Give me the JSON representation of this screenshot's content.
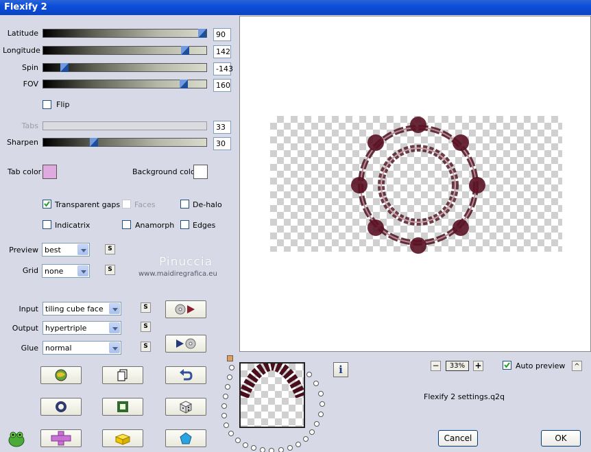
{
  "window": {
    "title": "Flexify 2"
  },
  "sliders": {
    "latitude": {
      "label": "Latitude",
      "value": "90",
      "fraction": 1.0
    },
    "longitude": {
      "label": "Longitude",
      "value": "142",
      "fraction": 0.89
    },
    "spin": {
      "label": "Spin",
      "value": "-143",
      "fraction": 0.11
    },
    "fov": {
      "label": "FOV",
      "value": "160",
      "fraction": 0.88
    },
    "tabs": {
      "label": "Tabs",
      "value": "33"
    },
    "sharpen": {
      "label": "Sharpen",
      "value": "30",
      "fraction": 0.3
    }
  },
  "flip": {
    "label": "Flip",
    "checked": false
  },
  "colors": {
    "tab_color_label": "Tab color",
    "tab_color": "#dfaae0",
    "background_color_label": "Background color",
    "background_color": "#ffffff"
  },
  "options": {
    "transparent_gaps": "Transparent gaps",
    "faces": "Faces",
    "de_halo": "De-halo",
    "indicatrix": "Indicatrix",
    "anamorph": "Anamorph",
    "edges": "Edges"
  },
  "preview_select": {
    "label": "Preview",
    "value": "best"
  },
  "grid_select": {
    "label": "Grid",
    "value": "none"
  },
  "input_select": {
    "label": "Input",
    "value": "tiling cube face"
  },
  "output_select": {
    "label": "Output",
    "value": "hypertriple"
  },
  "glue_select": {
    "label": "Glue",
    "value": "normal"
  },
  "s_label": "S",
  "watermark": {
    "name": "Pinuccia",
    "site": "www.maidiregrafica.eu"
  },
  "zoom": {
    "minus": "−",
    "value": "33%",
    "plus": "+"
  },
  "auto_preview": {
    "label": "Auto preview",
    "checked": true
  },
  "settings_file": "Flexify 2 settings.q2q",
  "buttons": {
    "cancel": "Cancel",
    "ok": "OK",
    "info": "i",
    "collapse": "^"
  }
}
